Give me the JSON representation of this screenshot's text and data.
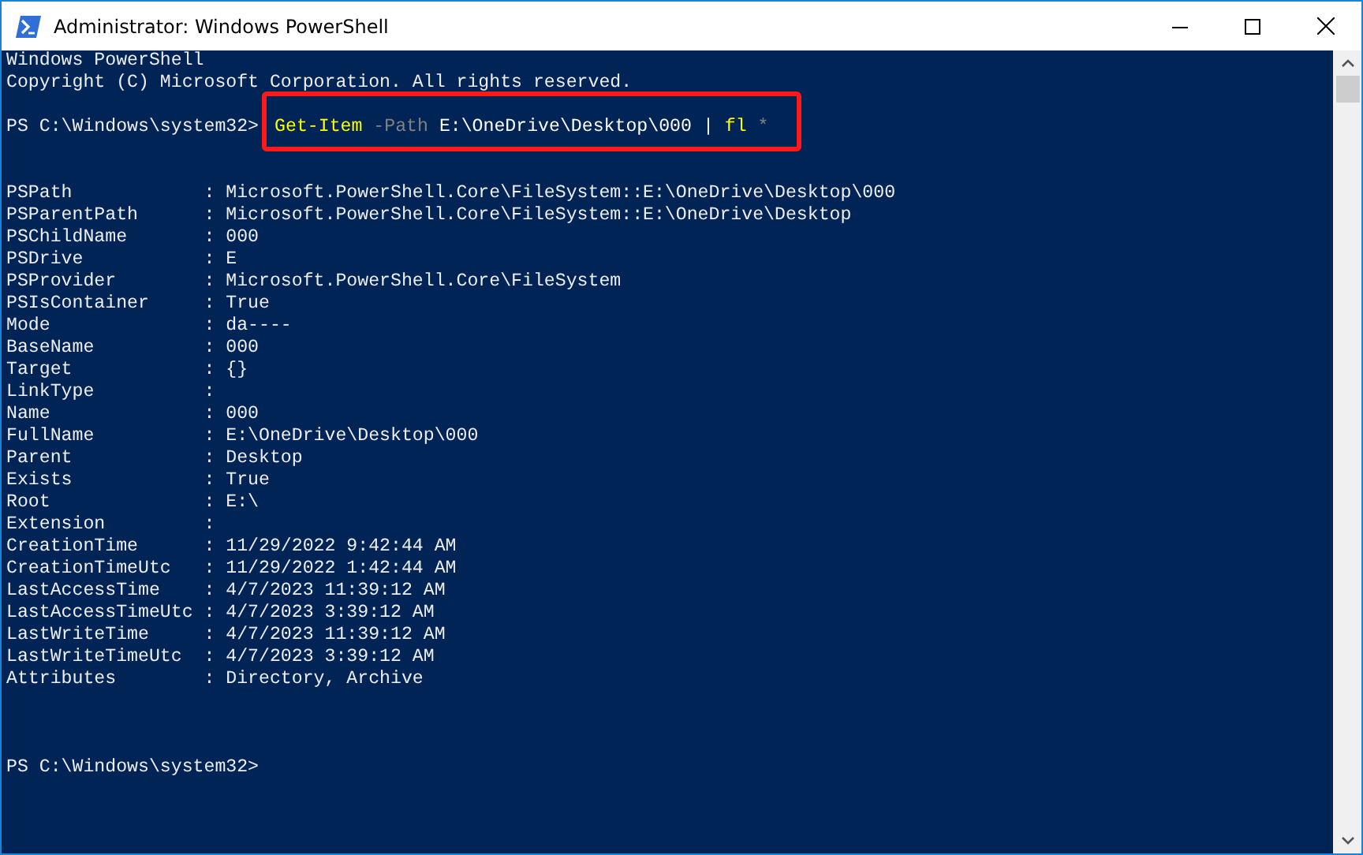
{
  "window": {
    "title": "Administrator: Windows PowerShell"
  },
  "console": {
    "header_lines": [
      "Windows PowerShell",
      "Copyright (C) Microsoft Corporation. All rights reserved."
    ],
    "prompt": "PS C:\\Windows\\system32>",
    "command": {
      "highlighted": true,
      "tokens": [
        {
          "kind": "cmdlet",
          "text": "Get-Item"
        },
        {
          "kind": "parameter",
          "text": "-Path"
        },
        {
          "kind": "argument",
          "text": "E:\\OneDrive\\Desktop\\000"
        },
        {
          "kind": "operator",
          "text": "|"
        },
        {
          "kind": "cmdlet",
          "text": "fl"
        },
        {
          "kind": "parameter",
          "text": "*"
        }
      ]
    },
    "separator": ":",
    "properties": [
      {
        "name": "PSPath",
        "value": "Microsoft.PowerShell.Core\\FileSystem::E:\\OneDrive\\Desktop\\000"
      },
      {
        "name": "PSParentPath",
        "value": "Microsoft.PowerShell.Core\\FileSystem::E:\\OneDrive\\Desktop"
      },
      {
        "name": "PSChildName",
        "value": "000"
      },
      {
        "name": "PSDrive",
        "value": "E"
      },
      {
        "name": "PSProvider",
        "value": "Microsoft.PowerShell.Core\\FileSystem"
      },
      {
        "name": "PSIsContainer",
        "value": "True"
      },
      {
        "name": "Mode",
        "value": "da----"
      },
      {
        "name": "BaseName",
        "value": "000"
      },
      {
        "name": "Target",
        "value": "{}"
      },
      {
        "name": "LinkType"
      },
      {
        "name": "Name",
        "value": "000"
      },
      {
        "name": "FullName",
        "value": "E:\\OneDrive\\Desktop\\000"
      },
      {
        "name": "Parent",
        "value": "Desktop"
      },
      {
        "name": "Exists",
        "value": "True"
      },
      {
        "name": "Root",
        "value": "E:\\"
      },
      {
        "name": "Extension"
      },
      {
        "name": "CreationTime",
        "value": "11/29/2022 9:42:44 AM"
      },
      {
        "name": "CreationTimeUtc",
        "value": "11/29/2022 1:42:44 AM"
      },
      {
        "name": "LastAccessTime",
        "value": "4/7/2023 11:39:12 AM"
      },
      {
        "name": "LastAccessTimeUtc",
        "value": "4/7/2023 3:39:12 AM"
      },
      {
        "name": "LastWriteTime",
        "value": "4/7/2023 11:39:12 AM"
      },
      {
        "name": "LastWriteTimeUtc",
        "value": "4/7/2023 3:39:12 AM"
      },
      {
        "name": "Attributes",
        "value": "Directory, Archive"
      }
    ],
    "final_prompt": "PS C:\\Windows\\system32>"
  }
}
